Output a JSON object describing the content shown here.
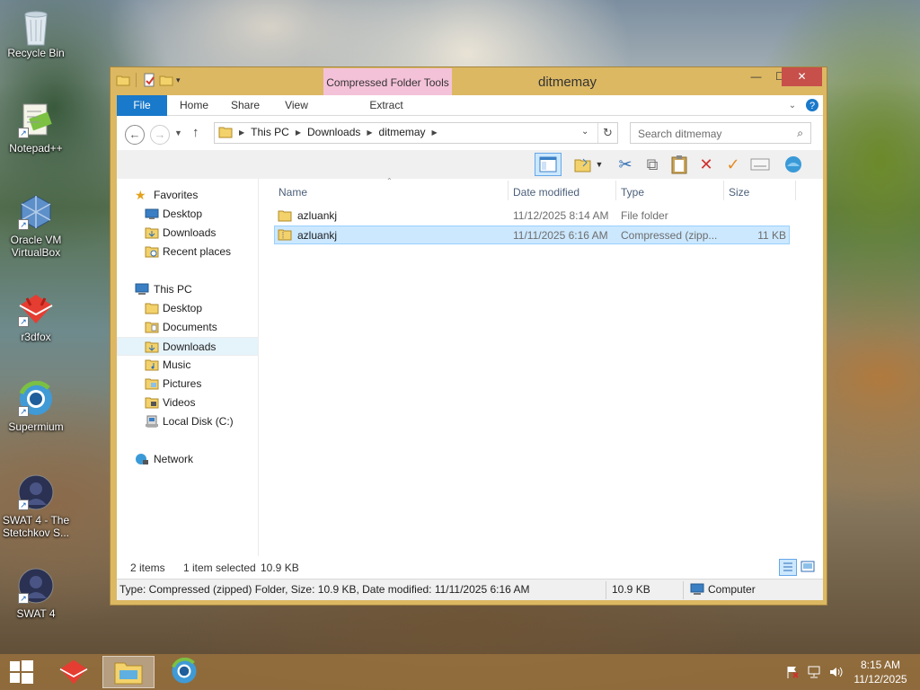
{
  "desktop": {
    "icons": [
      {
        "label": "Recycle Bin"
      },
      {
        "label": "Notepad++"
      },
      {
        "label": "Oracle VM VirtualBox"
      },
      {
        "label": "r3dfox"
      },
      {
        "label": "Supermium"
      },
      {
        "label": "SWAT 4 - The Stetchkov S..."
      },
      {
        "label": "SWAT 4"
      }
    ]
  },
  "window": {
    "title": "ditmemay",
    "context_tab": "Compressed Folder Tools",
    "ribbon_tabs": [
      "File",
      "Home",
      "Share",
      "View",
      "Extract"
    ],
    "address": {
      "crumbs": [
        "This PC",
        "Downloads",
        "ditmemay"
      ]
    },
    "search": {
      "placeholder": "Search ditmemay"
    },
    "nav": {
      "favorites_label": "Favorites",
      "favorites": [
        "Desktop",
        "Downloads",
        "Recent places"
      ],
      "thispc_label": "This PC",
      "thispc": [
        "Desktop",
        "Documents",
        "Downloads",
        "Music",
        "Pictures",
        "Videos",
        "Local Disk (C:)"
      ],
      "network_label": "Network",
      "selected": "Downloads"
    },
    "columns": [
      "Name",
      "Date modified",
      "Type",
      "Size"
    ],
    "files": [
      {
        "name": "azluankj",
        "date": "11/12/2025 8:14 AM",
        "type": "File folder",
        "size": ""
      },
      {
        "name": "azluankj",
        "date": "11/11/2025 6:16 AM",
        "type": "Compressed (zipp...",
        "size": "11 KB"
      }
    ],
    "status": {
      "items": "2 items",
      "selected": "1 item selected",
      "size": "10.9 KB"
    },
    "details_bar": {
      "description": "Type: Compressed (zipped) Folder, Size: 10.9 KB, Date modified: 11/11/2025 6:16 AM",
      "size": "10.9 KB",
      "location": "Computer"
    }
  },
  "taskbar": {
    "time": "8:15 AM",
    "date": "11/12/2025"
  }
}
